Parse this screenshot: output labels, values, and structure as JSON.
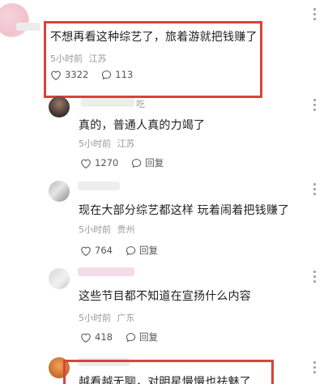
{
  "comments": [
    {
      "id": "c1",
      "text": "不想再看这种综艺了，旅着游就把钱赚了",
      "time": "5小时前",
      "location": "江苏",
      "likes": "3322",
      "replies": "113",
      "highlighted": true
    },
    {
      "id": "c2",
      "name_visible_suffix": "吃",
      "text": "真的，普通人真的力竭了",
      "time": "5小时前",
      "location": "江苏",
      "likes": "1270",
      "reply_label": "回复"
    },
    {
      "id": "c3",
      "text": "现在大部分综艺都这样 玩着闹着把钱赚了",
      "time": "5小时前",
      "location": "贵州",
      "likes": "764",
      "reply_label": "回复"
    },
    {
      "id": "c4",
      "text": "这些节目都不知道在宣扬什么内容",
      "time": "5小时前",
      "location": "广东",
      "likes": "418",
      "reply_label": "回复"
    },
    {
      "id": "c5",
      "text": "越看越无聊，对明星慢慢也祛魅了",
      "highlighted": true
    }
  ],
  "icons": {
    "like": "heart-outline-icon",
    "comment": "speech-bubble-icon",
    "reply": "speech-bubble-icon",
    "more": "vertical-dots-icon"
  },
  "colors": {
    "highlight_border": "#d9433a",
    "meta_text": "#9a9a9a",
    "body_text": "#1f1f1f"
  }
}
